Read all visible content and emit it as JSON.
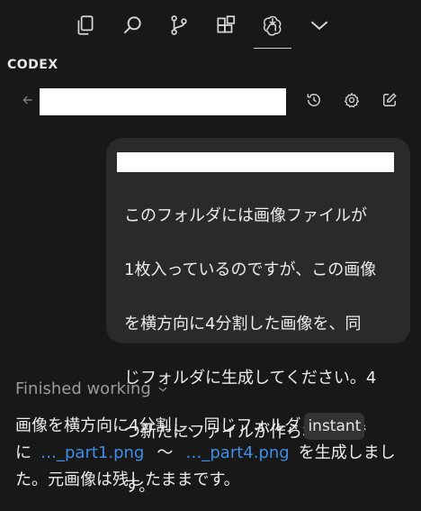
{
  "activity_bar": {
    "icons": [
      "explorer-icon",
      "search-icon",
      "source-control-icon",
      "extensions-icon",
      "codex-icon",
      "chevron-down-icon"
    ],
    "active": "codex-icon"
  },
  "panel": {
    "label": "CODEX"
  },
  "thread": {
    "title": "",
    "header_icons": [
      "history-icon",
      "settings-icon",
      "edit-icon"
    ]
  },
  "user_message": {
    "lines": [
      "このフォルダには画像ファイルが",
      "1枚入っているのですが、この画像",
      "を横方向に4分割した画像を、同",
      "じフォルダに生成してください。4",
      "つ新たにファイルが作られる形で",
      "す。"
    ]
  },
  "status": {
    "label": "Finished working"
  },
  "assistant_reply": {
    "line1_text": "画像を横方向に4分割し、同じフォルダ",
    "line1_code": "instant",
    "line2_prefix": "に",
    "link1": "…_part1.png",
    "tilde": "〜",
    "link2": "…_part4.png",
    "line2_suffix": "を生成しまし",
    "line3": "た。元画像は残したままです。"
  },
  "colors": {
    "background": "#181818",
    "bubble": "#2a2a2a",
    "link": "#3d8ee6",
    "muted": "#9a9a9a"
  }
}
